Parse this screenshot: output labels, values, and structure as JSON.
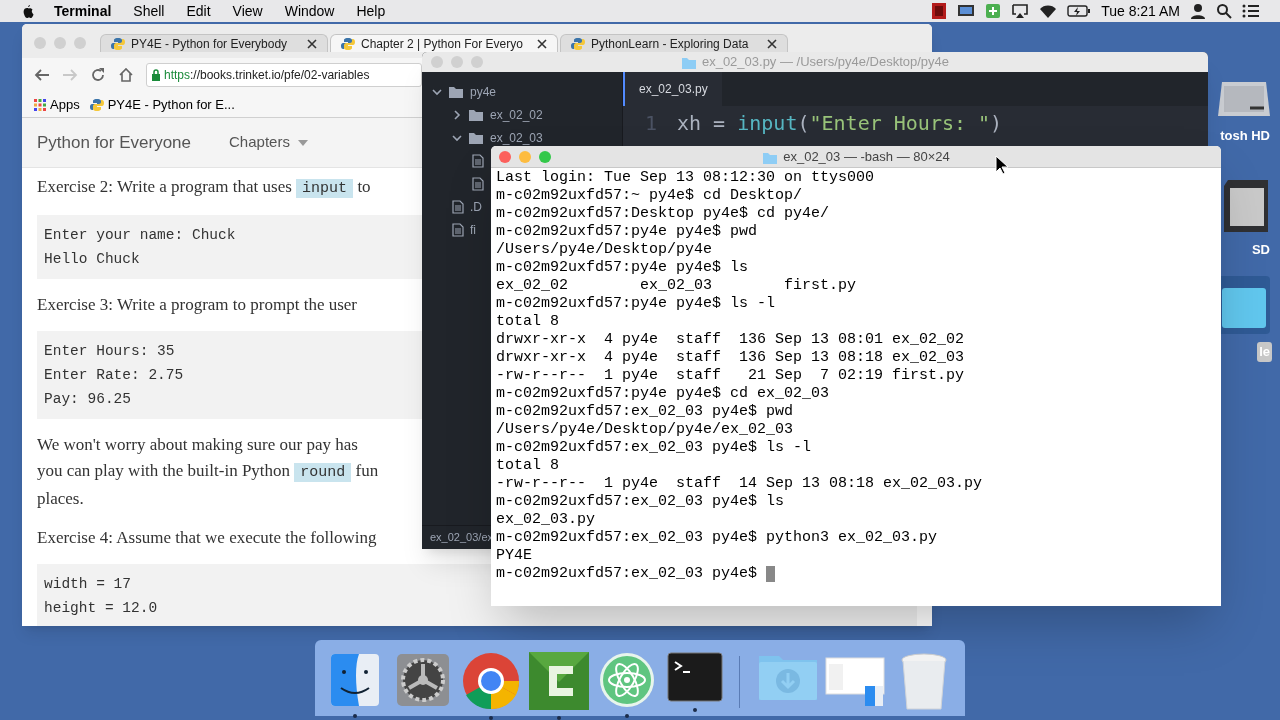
{
  "menu_bar": {
    "app_name": "Terminal",
    "menus": [
      "Shell",
      "Edit",
      "View",
      "Window",
      "Help"
    ],
    "clock": "Tue 8:21 AM"
  },
  "browser": {
    "tabs": [
      {
        "title": "PY4E - Python for Everybody",
        "selected": false
      },
      {
        "title": "Chapter 2 | Python For Everyo",
        "selected": true
      },
      {
        "title": "PythonLearn - Exploring Data",
        "selected": false
      }
    ],
    "url_scheme": "https",
    "url_rest": "://books.trinket.io/pfe/02-variables",
    "bookmarks": [
      "Apps",
      "PY4E - Python for E..."
    ],
    "site_title": "Python for Everyone",
    "nav_menu": "Chapters",
    "content": [
      {
        "kind": "paragraph",
        "lines": [
          [
            {
              "text": "Exercise 2: Write a program that uses ",
              "code": false
            },
            {
              "text": "input",
              "code": true
            },
            {
              "text": " to",
              "code": false
            }
          ]
        ]
      },
      {
        "kind": "code_block",
        "lines": [
          "Enter your name: Chuck",
          "Hello Chuck"
        ]
      },
      {
        "kind": "paragraph",
        "lines": [
          [
            {
              "text": "Exercise 3: Write a program to prompt the user",
              "code": false
            }
          ]
        ]
      },
      {
        "kind": "code_block",
        "lines": [
          "Enter Hours: 35",
          "Enter Rate: 2.75",
          "Pay: 96.25"
        ]
      },
      {
        "kind": "paragraph",
        "lines": [
          [
            {
              "text": "We won't worry about making sure our pay has",
              "code": false
            }
          ],
          [
            {
              "text": "you can play with the built-in Python ",
              "code": false
            },
            {
              "text": "round",
              "code": true
            },
            {
              "text": " fun",
              "code": false
            }
          ],
          [
            {
              "text": "places.",
              "code": false
            }
          ]
        ]
      },
      {
        "kind": "paragraph",
        "lines": [
          [
            {
              "text": "Exercise 4: Assume that we execute the following",
              "code": false
            }
          ]
        ]
      },
      {
        "kind": "code_block",
        "lines": [
          "width = 17",
          "height = 12.0"
        ]
      }
    ]
  },
  "editor": {
    "title": "ex_02_03.py — /Users/py4e/Desktop/py4e",
    "tree": [
      {
        "name": "py4e",
        "kind": "folder",
        "expanded": true,
        "children": [
          {
            "name": "ex_02_02",
            "kind": "folder",
            "expanded": false
          },
          {
            "name": "ex_02_03",
            "kind": "folder",
            "expanded": true,
            "children": [
              {
                "kind": "file"
              },
              {
                "kind": "file"
              }
            ]
          },
          {
            "name": ".D",
            "kind": "file"
          },
          {
            "name": "fi",
            "kind": "file"
          }
        ]
      }
    ],
    "tab": "ex_02_03.py",
    "code_lines": [
      {
        "number": "1",
        "tokens": [
          {
            "text": "xh = ",
            "kind": "plain"
          },
          {
            "text": "input",
            "kind": "builtin"
          },
          {
            "text": "(",
            "kind": "plain"
          },
          {
            "text": "\"Enter Hours: \"",
            "kind": "string"
          },
          {
            "text": ")",
            "kind": "plain"
          }
        ]
      }
    ],
    "status_path": "ex_02_03/ex"
  },
  "terminal": {
    "title": "ex_02_03 — -bash — 80×24",
    "lines": [
      "Last login: Tue Sep 13 08:12:30 on ttys000",
      "m-c02m92uxfd57:~ py4e$ cd Desktop/",
      "m-c02m92uxfd57:Desktop py4e$ cd py4e/",
      "m-c02m92uxfd57:py4e py4e$ pwd",
      "/Users/py4e/Desktop/py4e",
      "m-c02m92uxfd57:py4e py4e$ ls",
      "ex_02_02        ex_02_03        first.py",
      "m-c02m92uxfd57:py4e py4e$ ls -l",
      "total 8",
      "drwxr-xr-x  4 py4e  staff  136 Sep 13 08:01 ex_02_02",
      "drwxr-xr-x  4 py4e  staff  136 Sep 13 08:18 ex_02_03",
      "-rw-r--r--  1 py4e  staff   21 Sep  7 02:19 first.py",
      "m-c02m92uxfd57:py4e py4e$ cd ex_02_03",
      "m-c02m92uxfd57:ex_02_03 py4e$ pwd",
      "/Users/py4e/Desktop/py4e/ex_02_03",
      "m-c02m92uxfd57:ex_02_03 py4e$ ls -l",
      "total 8",
      "-rw-r--r--  1 py4e  staff  14 Sep 13 08:18 ex_02_03.py",
      "m-c02m92uxfd57:ex_02_03 py4e$ ls",
      "ex_02_03.py",
      "m-c02m92uxfd57:ex_02_03 py4e$ python3 ex_02_03.py",
      "PY4E",
      "m-c02m92uxfd57:ex_02_03 py4e$"
    ]
  },
  "desktop_icons": [
    {
      "label": "tosh HD",
      "kind": "drive"
    },
    {
      "label": "SD",
      "kind": "sd_card"
    },
    {
      "label": "le",
      "kind": "folder"
    }
  ],
  "dock": [
    {
      "kind": "finder",
      "running": true
    },
    {
      "kind": "settings",
      "running": false
    },
    {
      "kind": "chrome",
      "running": true
    },
    {
      "kind": "camtasia",
      "running": true
    },
    {
      "kind": "atom",
      "running": true
    },
    {
      "kind": "terminal",
      "running": true
    },
    {
      "kind": "separator",
      "running": false
    },
    {
      "kind": "downloads",
      "running": false
    },
    {
      "kind": "window",
      "running": false
    },
    {
      "kind": "trash",
      "running": false
    }
  ]
}
